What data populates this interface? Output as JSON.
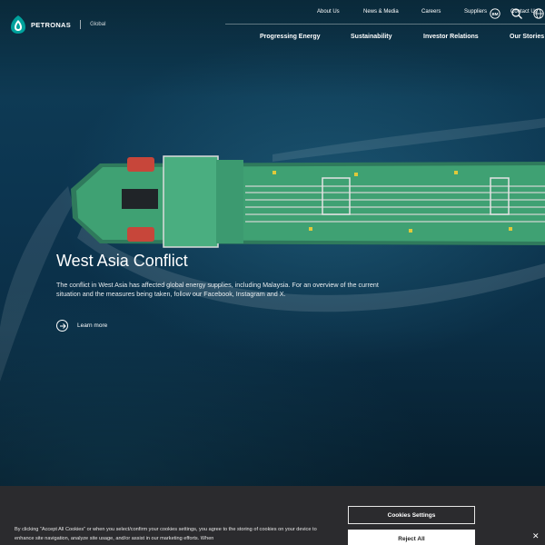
{
  "header": {
    "logo_text": "PETRONAS",
    "region": "Global",
    "utility_nav": [
      "About Us",
      "News & Media",
      "Careers",
      "Suppliers",
      "Contact Us"
    ],
    "main_nav": [
      "Progressing Energy",
      "Sustainability",
      "Investor Relations",
      "Our Stories"
    ],
    "icons": [
      "language-badge-icon",
      "search-icon",
      "globe-icon"
    ],
    "language_badge": "BM"
  },
  "hero": {
    "title": "West Asia Conflict",
    "description": "The conflict in West Asia has affected global energy supplies, including Malaysia. For an overview of the current situation and the measures being taken, follow our Facebook, Instagram and X.",
    "cta_label": "Learn more"
  },
  "cookie_banner": {
    "text": "By clicking “Accept All Cookies” or when you select/confirm your cookies settings, you agree to the storing of cookies on your device to enhance site navigation, analyze site usage, and/or assist in our marketing efforts. When",
    "settings_label": "Cookies Settings",
    "reject_label": "Reject All",
    "close_label": "✕"
  },
  "colors": {
    "brand_teal": "#00a19c",
    "ship_deck": "#3fa173",
    "banner_bg": "#2b2b2e"
  }
}
